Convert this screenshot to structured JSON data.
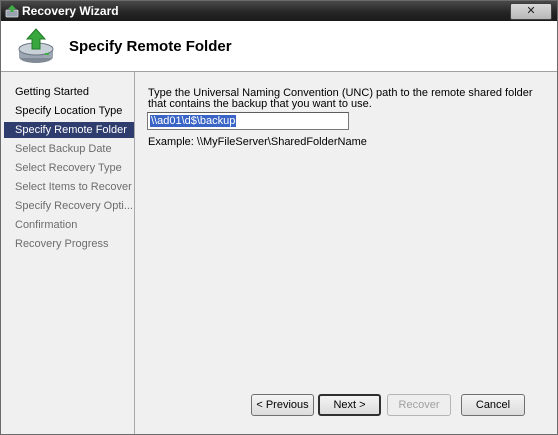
{
  "window": {
    "title": "Recovery Wizard",
    "close_label": "✕"
  },
  "header": {
    "title": "Specify Remote Folder",
    "icon": "backup-restore-icon"
  },
  "nav": {
    "items": [
      {
        "label": "Getting Started",
        "state": "done"
      },
      {
        "label": "Specify Location Type",
        "state": "done"
      },
      {
        "label": "Specify Remote Folder",
        "state": "current"
      },
      {
        "label": "Select Backup Date",
        "state": "pending"
      },
      {
        "label": "Select Recovery Type",
        "state": "pending"
      },
      {
        "label": "Select Items to Recover",
        "state": "pending"
      },
      {
        "label": "Specify Recovery Opti...",
        "state": "pending"
      },
      {
        "label": "Confirmation",
        "state": "pending"
      },
      {
        "label": "Recovery Progress",
        "state": "pending"
      }
    ]
  },
  "main": {
    "instruction": "Type the Universal Naming Convention (UNC) path to the remote shared folder that contains the backup that you want to use.",
    "path_value": "\\\\ad01\\d$\\backup",
    "example": "Example: \\\\MyFileServer\\SharedFolderName"
  },
  "buttons": {
    "previous": "< Previous",
    "next": "Next >",
    "recover": "Recover",
    "cancel": "Cancel"
  },
  "colors": {
    "selection": "#2e3c6e",
    "header_bg": "#ffffff",
    "titlebar": "#262626"
  }
}
